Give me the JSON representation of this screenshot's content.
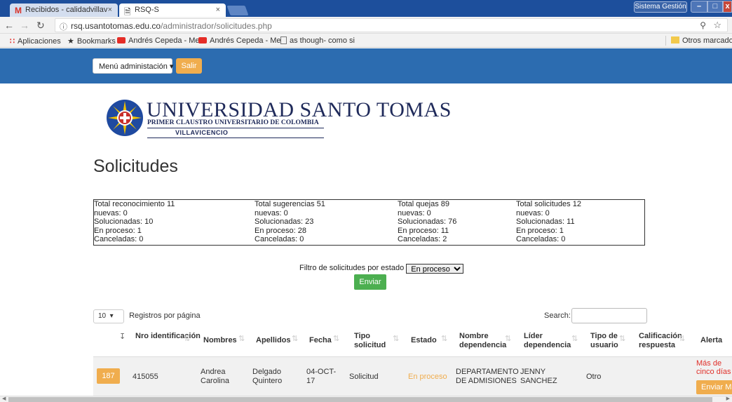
{
  "browser": {
    "tabs": [
      {
        "title": "Recibidos - calidadvillav",
        "icon": "gmail-icon"
      },
      {
        "title": "RSQ-S",
        "icon": "page-icon"
      }
    ],
    "tab_close": "×",
    "system_label": "Sistema Gestión",
    "window_controls": {
      "min": "–",
      "max": "□",
      "close": "x"
    },
    "url_host": "rsq.usantotomas.edu.co",
    "url_path": "/administrador/solicitudes.php",
    "bookmarks": [
      {
        "label": "Aplicaciones",
        "icon": "apps-icon"
      },
      {
        "label": "Bookmarks",
        "icon": "star-icon"
      },
      {
        "label": "Andrés Cepeda - Me",
        "icon": "youtube-icon"
      },
      {
        "label": "Andrés Cepeda - Me",
        "icon": "youtube-icon"
      },
      {
        "label": "as though- como si",
        "icon": "page-icon"
      }
    ],
    "other_bookmarks": "Otros marcadore"
  },
  "header": {
    "menu_label": "Menú administación ▾",
    "logout_label": "Salir"
  },
  "logo": {
    "title": "UNIVERSIDAD SANTO TOMAS",
    "subtitle": "PRIMER CLAUSTRO UNIVERSITARIO DE COLOMBIA",
    "city": "VILLAVICENCIO"
  },
  "page_title": "Solicitudes",
  "stats": [
    {
      "total": "Total reconocimiento 11",
      "nuevas": "nuevas: 0",
      "solucionadas": "Solucionadas: 10",
      "en_proceso": "En proceso: 1",
      "canceladas": "Canceladas: 0"
    },
    {
      "total": "Total sugerencias 51",
      "nuevas": "nuevas: 0",
      "solucionadas": "Solucionadas: 23",
      "en_proceso": "En proceso: 28",
      "canceladas": "Canceladas: 0"
    },
    {
      "total": "Total quejas 89",
      "nuevas": "nuevas: 0",
      "solucionadas": "Solucionadas: 76",
      "en_proceso": "En proceso: 11",
      "canceladas": "Canceladas: 2"
    },
    {
      "total": "Total solicitudes 12",
      "nuevas": "nuevas: 0",
      "solucionadas": "Solucionadas: 11",
      "en_proceso": "En proceso: 1",
      "canceladas": "Canceladas: 0"
    }
  ],
  "filter": {
    "label": "Filtro de solicitudes por estado",
    "selected": "En proceso",
    "submit": "Enviar"
  },
  "table_controls": {
    "page_length": "10",
    "page_length_label": "Registros por página",
    "search_label": "Search:"
  },
  "table": {
    "columns": [
      "",
      "Nro identificación",
      "Nombres",
      "Apellidos",
      "Fecha",
      "Tipo solicitud",
      "Estado",
      "Nombre dependencia",
      "Líder dependencia",
      "Tipo de usuario",
      "Calificación respuesta",
      "Alerta"
    ],
    "rows": [
      {
        "id": "187",
        "nro": "415055",
        "nombres": "Andrea Carolina",
        "apellidos": "Delgado Quintero",
        "fecha": "04-OCT-17",
        "tipo": "Solicitud",
        "estado": "En proceso",
        "dependencia": "DEPARTAMENTO DE ADMISIONES",
        "lider": "JENNY SANCHEZ",
        "tipo_usuario": "Otro",
        "calificacion": "",
        "alerta": "Más de cinco días",
        "alerta_btn": "Enviar Ma"
      }
    ]
  },
  "colors": {
    "appbar": "#2c6cb0",
    "warning": "#f0ad4e",
    "success": "#4caf50",
    "alert": "#e0302a"
  }
}
